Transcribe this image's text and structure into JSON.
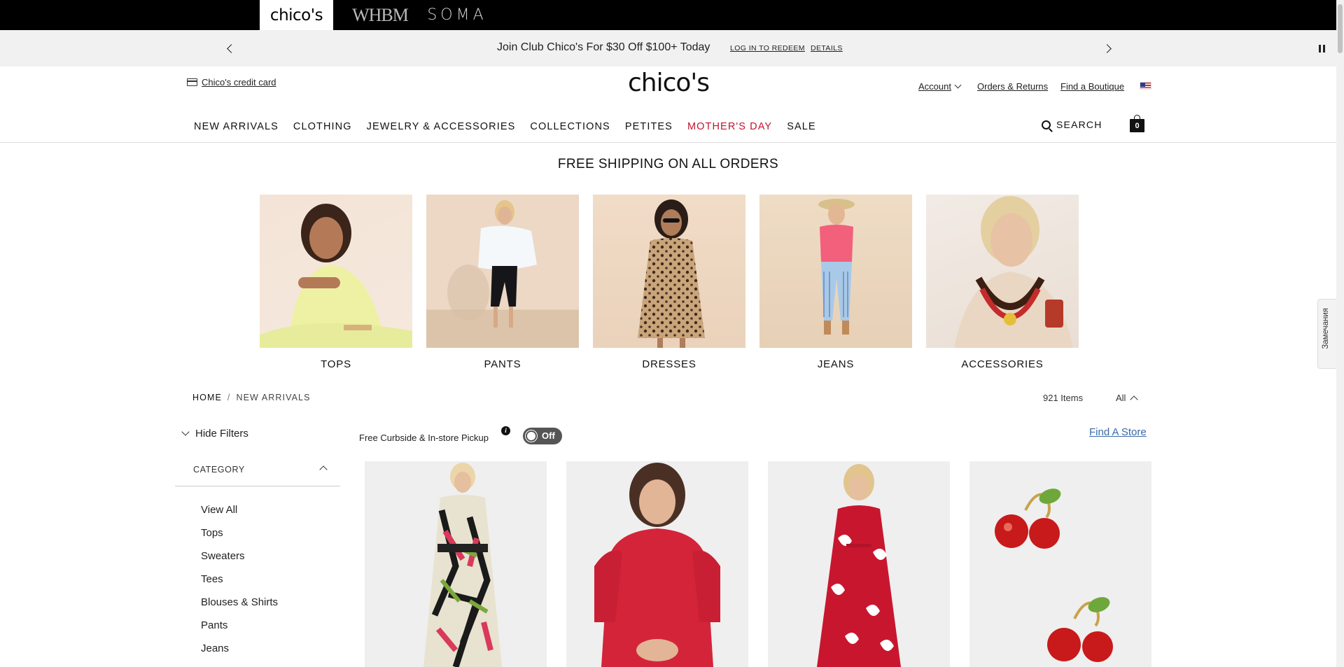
{
  "brands": {
    "chicos": "chico's",
    "whbm": "WHBM",
    "soma": "SOMA"
  },
  "promo": {
    "text": "Join Club Chico's For $30 Off $100+ Today",
    "login_link": "LOG IN TO REDEEM",
    "details_link": "DETAILS"
  },
  "header": {
    "credit_card": "Chico's credit card",
    "logo": "chico's",
    "account": "Account",
    "orders": "Orders & Returns",
    "boutique": "Find a Boutique",
    "search": "SEARCH",
    "bag_count": "0"
  },
  "nav": {
    "items": [
      "NEW ARRIVALS",
      "CLOTHING",
      "JEWELRY & ACCESSORIES",
      "COLLECTIONS",
      "PETITES",
      "MOTHER'S DAY",
      "SALE"
    ]
  },
  "banner": {
    "free_shipping": "FREE SHIPPING ON ALL ORDERS"
  },
  "categories": [
    "TOPS",
    "PANTS",
    "DRESSES",
    "JEANS",
    "ACCESSORIES"
  ],
  "breadcrumb": {
    "home": "HOME",
    "separator": "/",
    "current": "NEW ARRIVALS"
  },
  "results": {
    "count": "921 Items",
    "view": "All"
  },
  "filters": {
    "hide_label": "Hide Filters",
    "category_heading": "CATEGORY",
    "category_items": [
      "View All",
      "Tops",
      "Sweaters",
      "Tees",
      "Blouses & Shirts",
      "Pants",
      "Jeans"
    ]
  },
  "pickup": {
    "label": "Free Curbside & In-store Pickup",
    "info": "i",
    "toggle": "Off",
    "find_store": "Find A Store"
  },
  "side_tab": "Замечания",
  "colors": {
    "accent_red": "#c41230",
    "link_blue": "#3a6aa8",
    "brand_black": "#000000",
    "promo_bg": "#f1f1f1"
  }
}
